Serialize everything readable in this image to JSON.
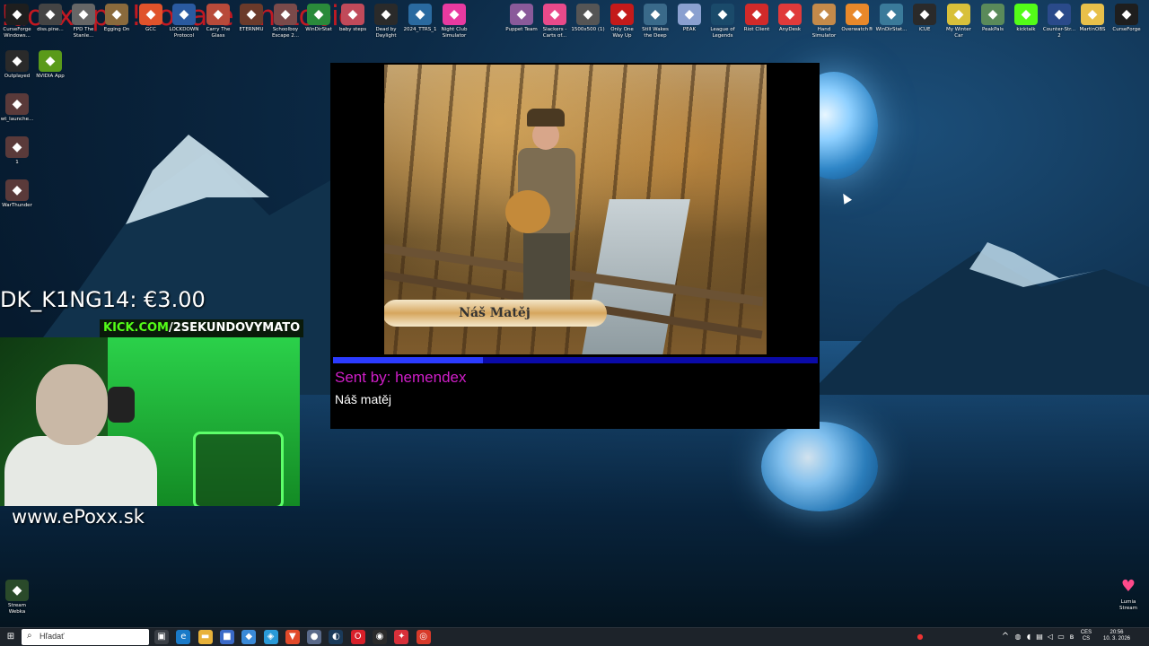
{
  "overlay": {
    "top_banner": "!doxx !pc !donate !instobic",
    "donation_line": "DK_K1NG14: €3.00",
    "kick_prefix": "KICK.COM",
    "kick_channel": "/2SEKUNDOVYMATO",
    "site_url": "www.ePoxx.sk"
  },
  "alert": {
    "video_title": "Náš Matěj",
    "progress_fraction": 0.31,
    "sent_by": "Sent by: hemendex",
    "message": "Náš matěj"
  },
  "desktop_icons_top": [
    {
      "label": "CurseForge Windows...",
      "icon": "curseforge-icon",
      "color": "#1e1e1e"
    },
    {
      "label": "diss.pine...",
      "icon": "app-icon",
      "color": "#444"
    },
    {
      "label": "FPD The Stanle...",
      "icon": "game-icon",
      "color": "#666"
    },
    {
      "label": "Egging On",
      "icon": "egg-icon",
      "color": "#8a6a3c"
    },
    {
      "label": "GCC",
      "icon": "gcc-icon",
      "color": "#e0532b"
    },
    {
      "label": "LOCKDOWN Protocol",
      "icon": "lockdown-icon",
      "color": "#2a5aa0"
    },
    {
      "label": "Carry The Glass",
      "icon": "glass-icon",
      "color": "#b84a3a"
    },
    {
      "label": "ETERNMU",
      "icon": "eternmu-icon",
      "color": "#6b3a2a"
    },
    {
      "label": "Schoolboy Escape 2...",
      "icon": "schoolboy-icon",
      "color": "#7a4a4a"
    },
    {
      "label": "WinDirStat",
      "icon": "windirstat-icon",
      "color": "#2a8a3a"
    },
    {
      "label": "baby steps",
      "icon": "babysteps-icon",
      "color": "#c04a5a"
    },
    {
      "label": "Dead by Daylight",
      "icon": "dbd-icon",
      "color": "#2a2a2a"
    },
    {
      "label": "2024_TTRS_1",
      "icon": "ttrs-icon",
      "color": "#2a6aa0"
    },
    {
      "label": "Night Club Simulator",
      "icon": "nightclub-icon",
      "color": "#e83aa0"
    },
    {
      "label": "Puppet Team",
      "icon": "puppet-icon",
      "color": "#8a5a9a"
    },
    {
      "label": "Slackers - Carts of...",
      "icon": "slackers-icon",
      "color": "#e84a8a"
    },
    {
      "label": "1500x500 (1)",
      "icon": "image-icon",
      "color": "#555"
    },
    {
      "label": "Only One Way Up",
      "icon": "onlyup-icon",
      "color": "#c41a1a"
    },
    {
      "label": "Still Wakes the Deep",
      "icon": "stillwakes-icon",
      "color": "#3a6a8a"
    },
    {
      "label": "PEAK",
      "icon": "peak-icon",
      "color": "#8aa0d0"
    },
    {
      "label": "League of Legends",
      "icon": "lol-icon",
      "color": "#1a4a6a"
    },
    {
      "label": "Riot Client",
      "icon": "riot-icon",
      "color": "#d12a2a"
    },
    {
      "label": "AnyDesk",
      "icon": "anydesk-icon",
      "color": "#e03a3a"
    },
    {
      "label": "Hand Simulator",
      "icon": "hand-icon",
      "color": "#c48a4a"
    },
    {
      "label": "Overwatch®",
      "icon": "overwatch-icon",
      "color": "#e8882a"
    },
    {
      "label": "WinDirStat...",
      "icon": "windirstat2-icon",
      "color": "#3a7a9a"
    },
    {
      "label": "iCUE",
      "icon": "icue-icon",
      "color": "#2a2a2a"
    },
    {
      "label": "My Winter Car",
      "icon": "winter-car-icon",
      "color": "#d8c03a"
    },
    {
      "label": "PeakPals",
      "icon": "peakpals-icon",
      "color": "#5a8a5a"
    },
    {
      "label": "kicktalk",
      "icon": "kick-icon",
      "color": "#53fc18"
    },
    {
      "label": "Counter-Str... 2",
      "icon": "cs2-icon",
      "color": "#2a4a8a"
    },
    {
      "label": "MartinOBS",
      "icon": "folder-icon",
      "color": "#e8c04a"
    },
    {
      "label": "CurseForge",
      "icon": "curseforge2-icon",
      "color": "#1e1e1e"
    }
  ],
  "desktop_icons_left": [
    {
      "label": "Outplayed",
      "icon": "outplayed-icon",
      "color": "#2a2a2a"
    },
    {
      "label": "NVIDIA App",
      "icon": "nvidia-icon",
      "color": "#5a9a1a"
    },
    {
      "label": "wt_launche...",
      "icon": "warthunder-launcher-icon",
      "color": "#5a3a3a"
    },
    {
      "label": "1",
      "icon": "warthunder-alt-icon",
      "color": "#5a3a3a"
    },
    {
      "label": "WarThunder",
      "icon": "warthunder-icon",
      "color": "#5a3a3a"
    },
    {
      "label": "Stream Webka",
      "icon": "stream-webka-icon",
      "color": "#2a4a2a"
    }
  ],
  "lumia": {
    "label": "Lumia Stream",
    "icon": "lumia-icon"
  },
  "taskbar": {
    "search_placeholder": "Hľadať",
    "pinned": [
      {
        "name": "task-view-icon",
        "glyph": "▣",
        "color": "#3a3f46"
      },
      {
        "name": "edge-icon",
        "glyph": "e",
        "color": "#1a7ac8"
      },
      {
        "name": "file-explorer-icon",
        "glyph": "▬",
        "color": "#e8b23a"
      },
      {
        "name": "store-icon",
        "glyph": "■",
        "color": "#3a6ac8"
      },
      {
        "name": "app-blue-icon",
        "glyph": "◆",
        "color": "#3a8ad8"
      },
      {
        "name": "app-teal-icon",
        "glyph": "◈",
        "color": "#2a9ad8"
      },
      {
        "name": "brave-icon",
        "glyph": "▼",
        "color": "#e24a2a"
      },
      {
        "name": "app-gray-icon",
        "glyph": "●",
        "color": "#5a6a8a"
      },
      {
        "name": "steam-icon",
        "glyph": "◐",
        "color": "#1a3a5a"
      },
      {
        "name": "opera-icon",
        "glyph": "O",
        "color": "#d8202a"
      },
      {
        "name": "obs-icon",
        "glyph": "◉",
        "color": "#2a2a2a"
      },
      {
        "name": "pin-icon",
        "glyph": "✦",
        "color": "#d8303a"
      },
      {
        "name": "chrome-icon",
        "glyph": "◎",
        "color": "#d83a2a"
      }
    ],
    "language": "CES",
    "language_sub": "CS",
    "time": "20:56",
    "date": "10. 3. 2026"
  }
}
